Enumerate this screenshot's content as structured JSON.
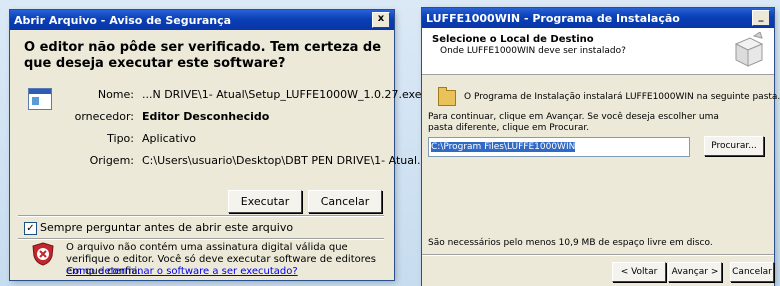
{
  "left_window": {
    "title": "Abrir Arquivo - Aviso de Segurança",
    "close_label": "x",
    "heading": "O editor não pôde ser verificado. Tem certeza de que deseja executar este software?",
    "fields": [
      {
        "label": "Nome:",
        "value": "...N DRIVE\\1- Atual\\Setup_LUFFE1000W_1.0.27.exe",
        "bold": false
      },
      {
        "label": "ornecedor:",
        "value": "Editor Desconhecido",
        "bold": true
      },
      {
        "label": "Tipo:",
        "value": "Aplicativo",
        "bold": false
      },
      {
        "label": "Origem:",
        "value": "C:\\Users\\usuario\\Desktop\\DBT PEN DRIVE\\1- Atual...",
        "bold": false
      }
    ],
    "run_button": "Executar",
    "cancel_button": "Cancelar",
    "checkbox_label": "Sempre perguntar antes de abrir este arquivo",
    "checkbox_checked": true,
    "warning_text": "O arquivo não contém uma assinatura digital válida que verifique o editor. Você só deve executar software de editores em que confia.",
    "warning_link": "Como determinar o software a ser executado?"
  },
  "right_window": {
    "title": "LUFFE1000WIN - Programa de Instalação",
    "header_title": "Selecione o Local de Destino",
    "header_subtitle": "Onde LUFFE1000WIN deve ser instalado?",
    "info_text": "O Programa de Instalação instalará LUFFE1000WIN na seguinte pasta.",
    "instructions": "Para continuar, clique em Avançar. Se você deseja escolher uma pasta diferente, clique em Procurar.",
    "path_value": "C:\\Program Files\\LUFFE1000WIN",
    "browse_button": "Procurar...",
    "space_text": "São necessários pelo menos 10,9 MB de espaço livre em disco.",
    "back_button": "< Voltar",
    "next_button": "Avançar >",
    "cancel_button": "Cancelar"
  }
}
